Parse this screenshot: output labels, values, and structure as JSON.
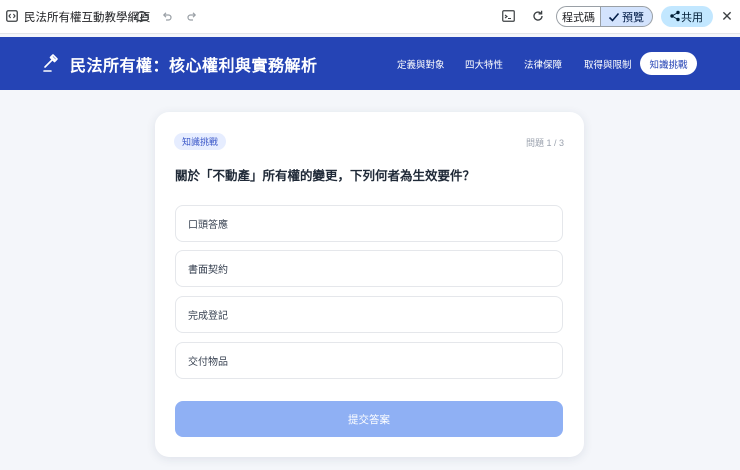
{
  "appbar": {
    "doc_title": "民法所有權互動教學網頁",
    "code_label": "程式碼",
    "preview_label": "預覽",
    "share_label": "共用"
  },
  "header": {
    "title": "民法所有權：核心權利與實務解析",
    "nav": [
      {
        "label": "定義與對象"
      },
      {
        "label": "四大特性"
      },
      {
        "label": "法律保障"
      },
      {
        "label": "取得與限制"
      },
      {
        "label": "知識挑戰"
      }
    ]
  },
  "quiz": {
    "tag": "知識挑戰",
    "progress": "問題 1 / 3",
    "question": "關於「不動產」所有權的變更，下列何者為生效要件？",
    "options": [
      {
        "label": "口頭答應"
      },
      {
        "label": "書面契約"
      },
      {
        "label": "完成登記"
      },
      {
        "label": "交付物品"
      }
    ],
    "submit_label": "提交答案"
  },
  "colors": {
    "banner": "#2544b5",
    "submit_disabled": "#8fb0f4",
    "preview_active": "#d3e3fd",
    "share": "#c2e7ff"
  }
}
